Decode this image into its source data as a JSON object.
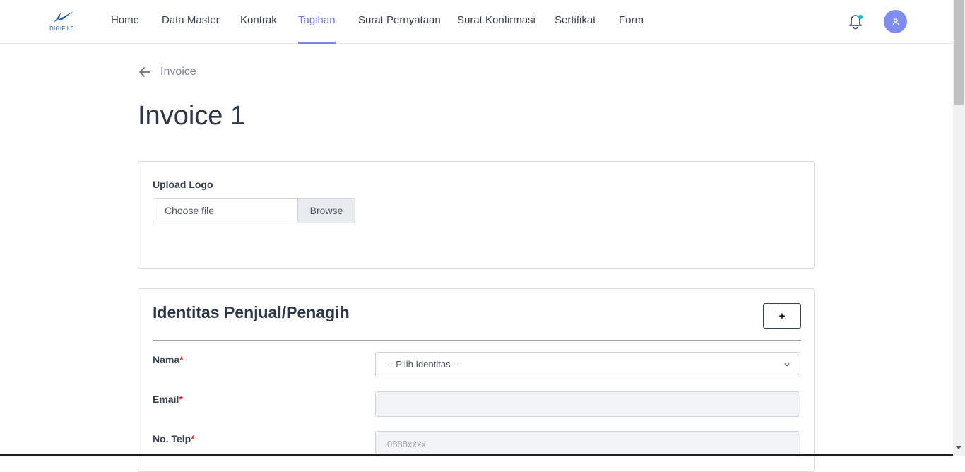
{
  "brand": {
    "logo_text": "DIGIFILE",
    "accent_color": "#7c86e8"
  },
  "nav": {
    "items": [
      {
        "label": "Home",
        "active": false
      },
      {
        "label": "Data Master",
        "active": false
      },
      {
        "label": "Kontrak",
        "active": false
      },
      {
        "label": "Tagihan",
        "active": true
      },
      {
        "label": "Surat Pernyataan",
        "active": false
      },
      {
        "label": "Surat Konfirmasi",
        "active": false
      },
      {
        "label": "Sertifikat",
        "active": false
      },
      {
        "label": "Form",
        "active": false
      }
    ],
    "notification_icon": "bell-icon",
    "avatar_icon": "user-icon"
  },
  "breadcrumb": {
    "back_label": "Invoice",
    "icon": "arrow-left-icon"
  },
  "page": {
    "title": "Invoice 1"
  },
  "upload_card": {
    "label": "Upload Logo",
    "file_placeholder": "Choose file",
    "browse_label": "Browse"
  },
  "seller_card": {
    "title": "Identitas Penjual/Penagih",
    "add_label": "+",
    "fields": {
      "nama_label": "Nama",
      "nama_select_value": "-- Pilih Identitas --",
      "email_label": "Email",
      "email_value": "",
      "telp_label": "No. Telp",
      "telp_placeholder": "0888xxxx",
      "required_mark": "*"
    }
  }
}
